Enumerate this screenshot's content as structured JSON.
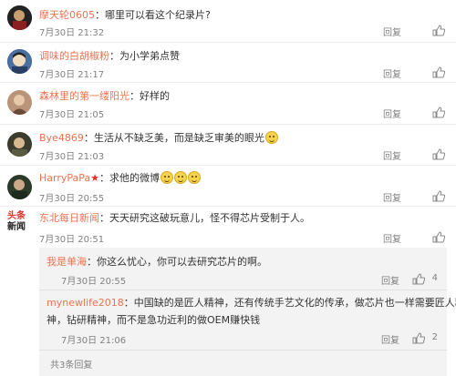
{
  "comments": [
    {
      "user": "摩天轮0605",
      "sep": "：",
      "text": "哪里可以看这个纪录片?",
      "time": "7月30日 21:32",
      "reply": "回复"
    },
    {
      "user": "调味的白胡椒粉",
      "sep": "：",
      "text": "为小学弟点赞",
      "time": "7月30日 21:17",
      "reply": "回复"
    },
    {
      "user": "森林里的第一缕阳光",
      "sep": "：",
      "text": "好样的",
      "time": "7月30日 21:05",
      "reply": "回复"
    },
    {
      "user": "Bye4869",
      "sep": "：",
      "text": "生活从不缺乏美，而是缺乏审美的眼光",
      "time": "7月30日 21:03",
      "reply": "回复"
    },
    {
      "user": "HarryPaPa",
      "sep": "：",
      "text": "求他的微博",
      "time": "7月30日 20:55",
      "reply": "回复"
    },
    {
      "user": "东北每日新闻",
      "sep": "：",
      "text": "天天研究这破玩意儿，怪不得芯片受制于人。",
      "time": "7月30日 20:51",
      "reply": "回复",
      "avatar_text": [
        "头条",
        "新闻"
      ]
    }
  ],
  "replies": [
    {
      "user": "我是单海",
      "sep": "：",
      "text": "你这么忧心，你可以去研究芯片的啊。",
      "time": "7月30日 20:55",
      "reply": "回复",
      "likes": "4"
    },
    {
      "user": "mynewlife2018",
      "sep": "：",
      "text": "中国缺的是匠人精神，还有传统手艺文化的传承，做芯片也一样需要匠人精",
      "text2": "神，钻研精神，而不是急功近利的做OEM赚快钱",
      "time": "7月30日 21:06",
      "reply": "回复",
      "likes": "2"
    }
  ],
  "more_replies": "共3条回复",
  "colors": {
    "username": "#eb7350",
    "text": "#333333",
    "meta": "#808080",
    "sub_bg": "#f3f3f3"
  },
  "icons": {
    "like": "thumbs-up-icon",
    "vip": "star-icon",
    "emoji": "smile-emoji-icon"
  }
}
